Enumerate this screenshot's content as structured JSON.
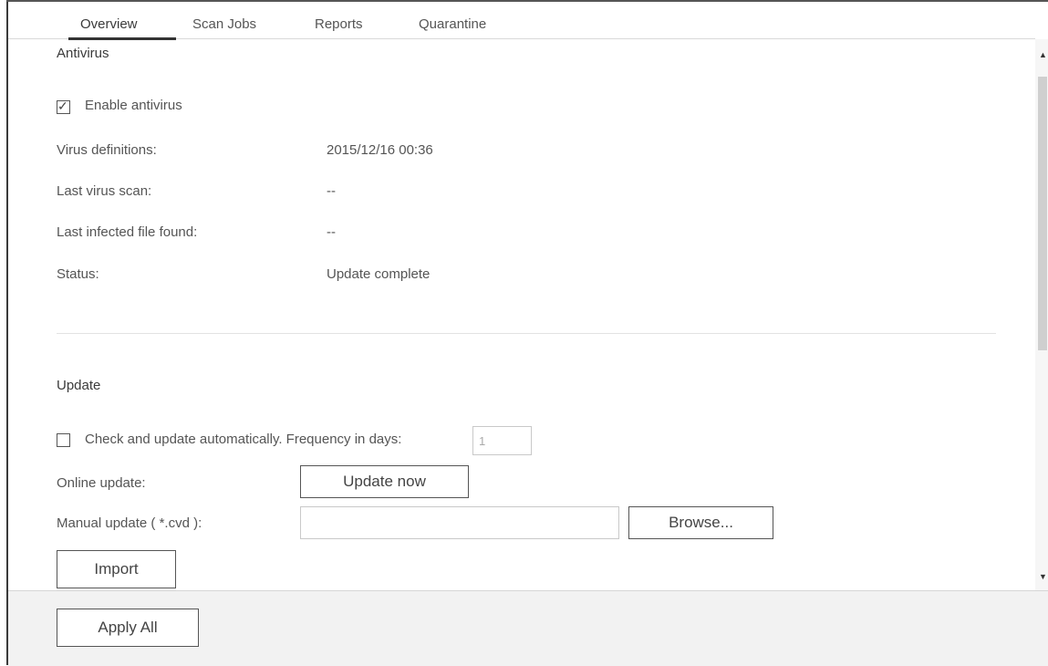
{
  "tabs": [
    {
      "label": "Overview",
      "active": true
    },
    {
      "label": "Scan Jobs",
      "active": false
    },
    {
      "label": "Reports",
      "active": false
    },
    {
      "label": "Quarantine",
      "active": false
    }
  ],
  "antivirus": {
    "title": "Antivirus",
    "enable_label": "Enable antivirus",
    "enable_checked": true,
    "definitions_label": "Virus definitions:",
    "definitions_value": "2015/12/16 00:36",
    "last_scan_label": "Last virus scan:",
    "last_scan_value": "--",
    "last_infected_label": "Last infected file found:",
    "last_infected_value": "--",
    "status_label": "Status:",
    "status_value": "Update complete"
  },
  "update": {
    "title": "Update",
    "auto_label": "Check and update automatically. Frequency in days:",
    "auto_checked": false,
    "frequency_value": "1",
    "online_label": "Online update:",
    "update_now_label": "Update now",
    "manual_label": "Manual update ( *.cvd ):",
    "manual_value": "",
    "browse_label": "Browse...",
    "import_label": "Import"
  },
  "footer": {
    "apply_all_label": "Apply All"
  },
  "icons": {
    "checkbox_checked": "checkbox-checked-icon",
    "checkbox_unchecked": "checkbox-unchecked-icon",
    "scroll_up": "scroll-up-arrow-icon",
    "scroll_down": "scroll-down-arrow-icon"
  }
}
